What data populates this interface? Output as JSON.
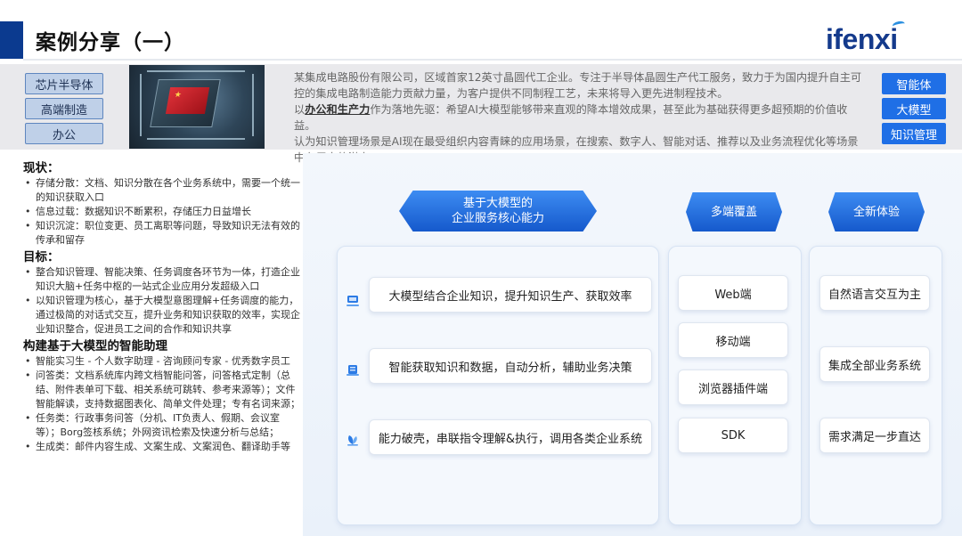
{
  "header": {
    "title": "案例分享（一）",
    "logo": "ifenxi"
  },
  "banner": {
    "tags": [
      "芯片半导体",
      "高端制造",
      "办公"
    ],
    "text_line1": "某集成电路股份有限公司，区域首家12英寸晶圆代工企业。专注于半导体晶圆生产代工服务，致力于为国内提升自主可控的集成电路制造能力贡献力量，为客户提供不同制程工艺，未来将导入更先进制程技术。",
    "text_line2_prefix": "以",
    "text_line2_highlight": "办公和生产力",
    "text_line2_rest": "作为落地先驱：希望AI大模型能够带来直观的降本增效成果，甚至此为基础获得更多超预期的价值收益。",
    "text_line3": "认为知识管理场景是AI现在最受组织内容青睐的应用场景，在搜索、数字人、智能对话、推荐以及业务流程优化等场景中有巨大的潜力。",
    "categories": [
      "智能体",
      "大模型",
      "知识管理"
    ]
  },
  "left": {
    "status_title": "现状：",
    "status_items": [
      "存储分散：文档、知识分散在各个业务系统中，需要一个统一的知识获取入口",
      "信息过载：数据知识不断累积，存储压力日益增长",
      "知识沉淀：职位变更、员工离职等问题，导致知识无法有效的传承和留存"
    ],
    "goal_title": "目标：",
    "goal_items": [
      "整合知识管理、智能决策、任务调度各环节为一体，打造企业知识大脑+任务中枢的一站式企业应用分发超级入口",
      "以知识管理为核心，基于大模型意图理解+任务调度的能力，通过极简的对话式交互，提升业务和知识获取的效率，实现企业知识整合，促进员工之间的合作和知识共享"
    ],
    "build_title": "构建基于大模型的智能助理",
    "build_items": [
      "智能实习生 - 个人数字助理 - 咨询顾问专家 - 优秀数字员工",
      "问答类：文档系统库内跨文档智能问答，问答格式定制（总结、附件表单可下载、相关系统可跳转、参考来源等）；文件智能解读，支持数据图表化、简单文件处理；专有名词来源；",
      "任务类：行政事务问答（分机、IT负责人、假期、会议室等）；Borg签核系统；外网资讯检索及快速分析与总结；",
      "生成类：邮件内容生成、文案生成、文案润色、翻译助手等"
    ]
  },
  "diagram": {
    "col1_title_line1": "基于大模型的",
    "col1_title_line2": "企业服务核心能力",
    "col1_items": [
      "大模型结合企业知识，提升知识生产、获取效率",
      "智能获取知识和数据，自动分析，辅助业务决策",
      "能力破壳，串联指令理解&执行，调用各类企业系统"
    ],
    "col2_title": "多端覆盖",
    "col2_items": [
      "Web端",
      "移动端",
      "浏览器插件端",
      "SDK"
    ],
    "col3_title": "全新体验",
    "col3_items": [
      "自然语言交互为主",
      "集成全部业务系统",
      "需求满足一步直达"
    ]
  },
  "colors": {
    "accent": "#1f6fe6",
    "header_bar": "#0b3a8f",
    "tag_fill": "#bfd0e8"
  }
}
